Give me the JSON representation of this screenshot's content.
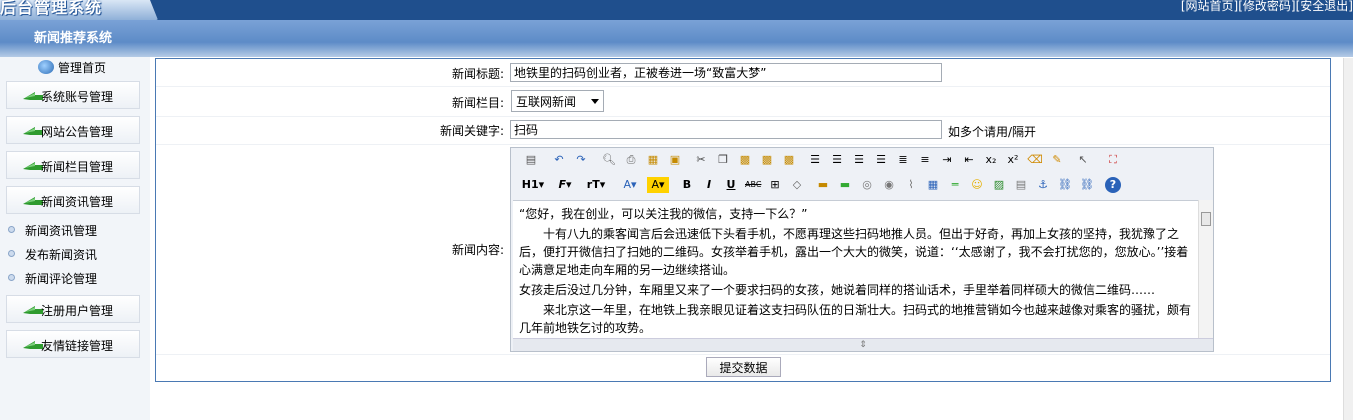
{
  "header": {
    "logo_text": "后台管理系统",
    "links": [
      "[网站首页]",
      "[修改密码]",
      "[安全退出]"
    ]
  },
  "section": {
    "title": "新闻推荐系统"
  },
  "sidebar": {
    "home": "管理首页",
    "items": [
      {
        "label": "系统账号管理"
      },
      {
        "label": "网站公告管理"
      },
      {
        "label": "新闻栏目管理"
      },
      {
        "label": "新闻资讯管理"
      }
    ],
    "subitems": [
      "新闻资讯管理",
      "发布新闻资讯",
      "新闻评论管理"
    ],
    "items2": [
      {
        "label": "注册用户管理"
      },
      {
        "label": "友情链接管理"
      }
    ]
  },
  "form": {
    "title_label": "新闻标题:",
    "title_value": "地铁里的扫码创业者，正被卷进一场“致富大梦”",
    "category_label": "新闻栏目:",
    "category_value": "互联网新闻",
    "keyword_label": "新闻关键字:",
    "keyword_value": "扫码",
    "keyword_hint": "如多个请用/隔开",
    "content_label": "新闻内容:",
    "submit_label": "提交数据"
  },
  "editor": {
    "paragraphs": [
      "“您好，我在创业，可以关注我的微信，支持一下么？”",
      "十有八九的乘客闻言后会迅速低下头看手机，不愿再理这些扫码地推人员。但出于好奇，再加上女孩的坚持，我犹豫了之后，便打开微信扫了扫她的二维码。女孩举着手机，露出一个大大的微笑，说道：‘‘太感谢了，我不会打扰您的，您放心。’’接着心满意足地走向车厢的另一边继续搭讪。",
      "女孩走后没过几分钟，车厢里又来了一个要求扫码的女孩，她说着同样的搭讪话术，手里举着同样硕大的微信二维码……",
      "来北京这一年里，在地铁上我亲眼见证着这支扫码队伍的日渐壮大。扫码式的地推营销如今也越来越像对乘客的骚扰，颇有几年前地铁乞讨的攻势。"
    ],
    "toolbar_row2_labels": [
      "H1",
      "F",
      "rT"
    ]
  },
  "colors": {
    "topbar": "#1f4f8d",
    "panel_border": "#4a79b3",
    "menu_arrow": "#2f9b2f"
  }
}
